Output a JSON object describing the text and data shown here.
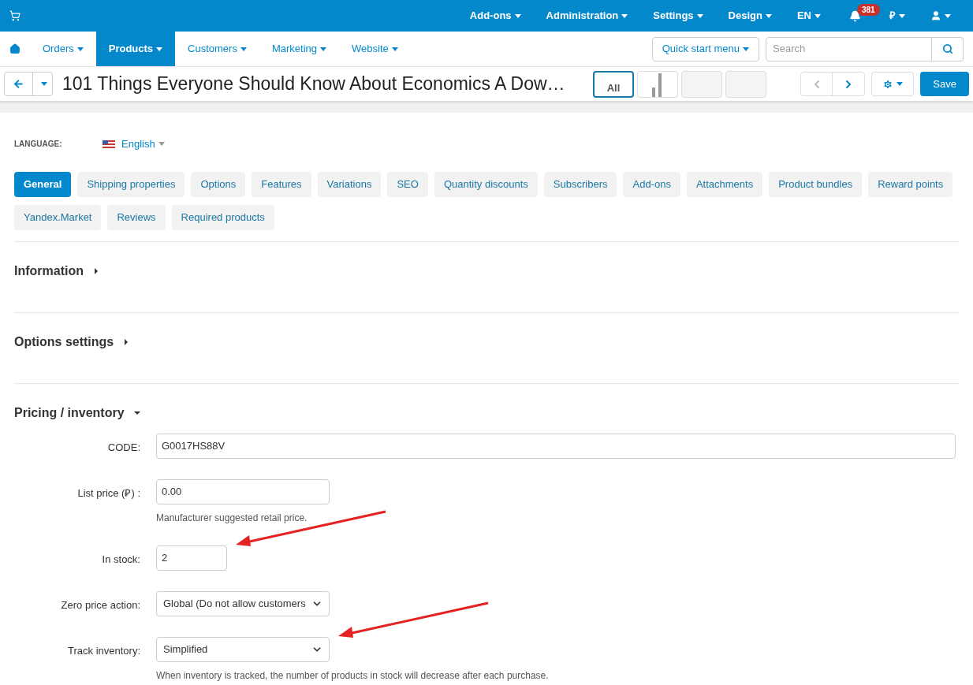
{
  "top_bar": {
    "menus": [
      {
        "label": "Add-ons"
      },
      {
        "label": "Administration"
      },
      {
        "label": "Settings"
      },
      {
        "label": "Design"
      },
      {
        "label": "EN"
      }
    ],
    "notification_count": "381",
    "currency": "₽"
  },
  "nav": {
    "items": [
      {
        "label": "Orders",
        "selected": false
      },
      {
        "label": "Products",
        "selected": true
      },
      {
        "label": "Customers",
        "selected": false
      },
      {
        "label": "Marketing",
        "selected": false
      },
      {
        "label": "Website",
        "selected": false
      }
    ],
    "quick_start": "Quick start menu",
    "search_placeholder": "Search"
  },
  "toolbar": {
    "title": "101 Things Everyone Should Know About Economics A Dow…",
    "views": [
      {
        "kind": "text",
        "label": "All",
        "selected": true
      },
      {
        "kind": "chart",
        "selected": false
      },
      {
        "kind": "image",
        "selected": false
      },
      {
        "kind": "image",
        "selected": false
      }
    ],
    "save": "Save"
  },
  "language": {
    "label": "LANGUAGE:",
    "value": "English"
  },
  "tabs": [
    {
      "label": "General",
      "selected": true
    },
    {
      "label": "Shipping properties",
      "selected": false
    },
    {
      "label": "Options",
      "selected": false
    },
    {
      "label": "Features",
      "selected": false
    },
    {
      "label": "Variations",
      "selected": false
    },
    {
      "label": "SEO",
      "selected": false
    },
    {
      "label": "Quantity discounts",
      "selected": false
    },
    {
      "label": "Subscribers",
      "selected": false
    },
    {
      "label": "Add-ons",
      "selected": false
    },
    {
      "label": "Attachments",
      "selected": false
    },
    {
      "label": "Product bundles",
      "selected": false
    },
    {
      "label": "Reward points",
      "selected": false
    },
    {
      "label": "Yandex.Market",
      "selected": false
    },
    {
      "label": "Reviews",
      "selected": false
    },
    {
      "label": "Required products",
      "selected": false
    }
  ],
  "sections": [
    {
      "title": "Information",
      "expanded": false
    },
    {
      "title": "Options settings",
      "expanded": false
    },
    {
      "title": "Pricing / inventory",
      "expanded": true
    }
  ],
  "fields": [
    {
      "kind": "text",
      "label": "CODE:",
      "value": "G0017HS88V",
      "arrow": false
    },
    {
      "kind": "text",
      "label": "List price (₽) :",
      "value": "0.00",
      "hint": "Manufacturer suggested retail price.",
      "arrow": false
    },
    {
      "kind": "text",
      "label": "In stock:",
      "value": "2",
      "arrow": true
    },
    {
      "kind": "select",
      "label": "Zero price action:",
      "value": "Global (Do not allow customers",
      "arrow": false
    },
    {
      "kind": "select",
      "label": "Track inventory:",
      "value": "Simplified",
      "hint": "When inventory is tracked, the number of products in stock will decrease after each purchase.",
      "arrow": true
    }
  ]
}
